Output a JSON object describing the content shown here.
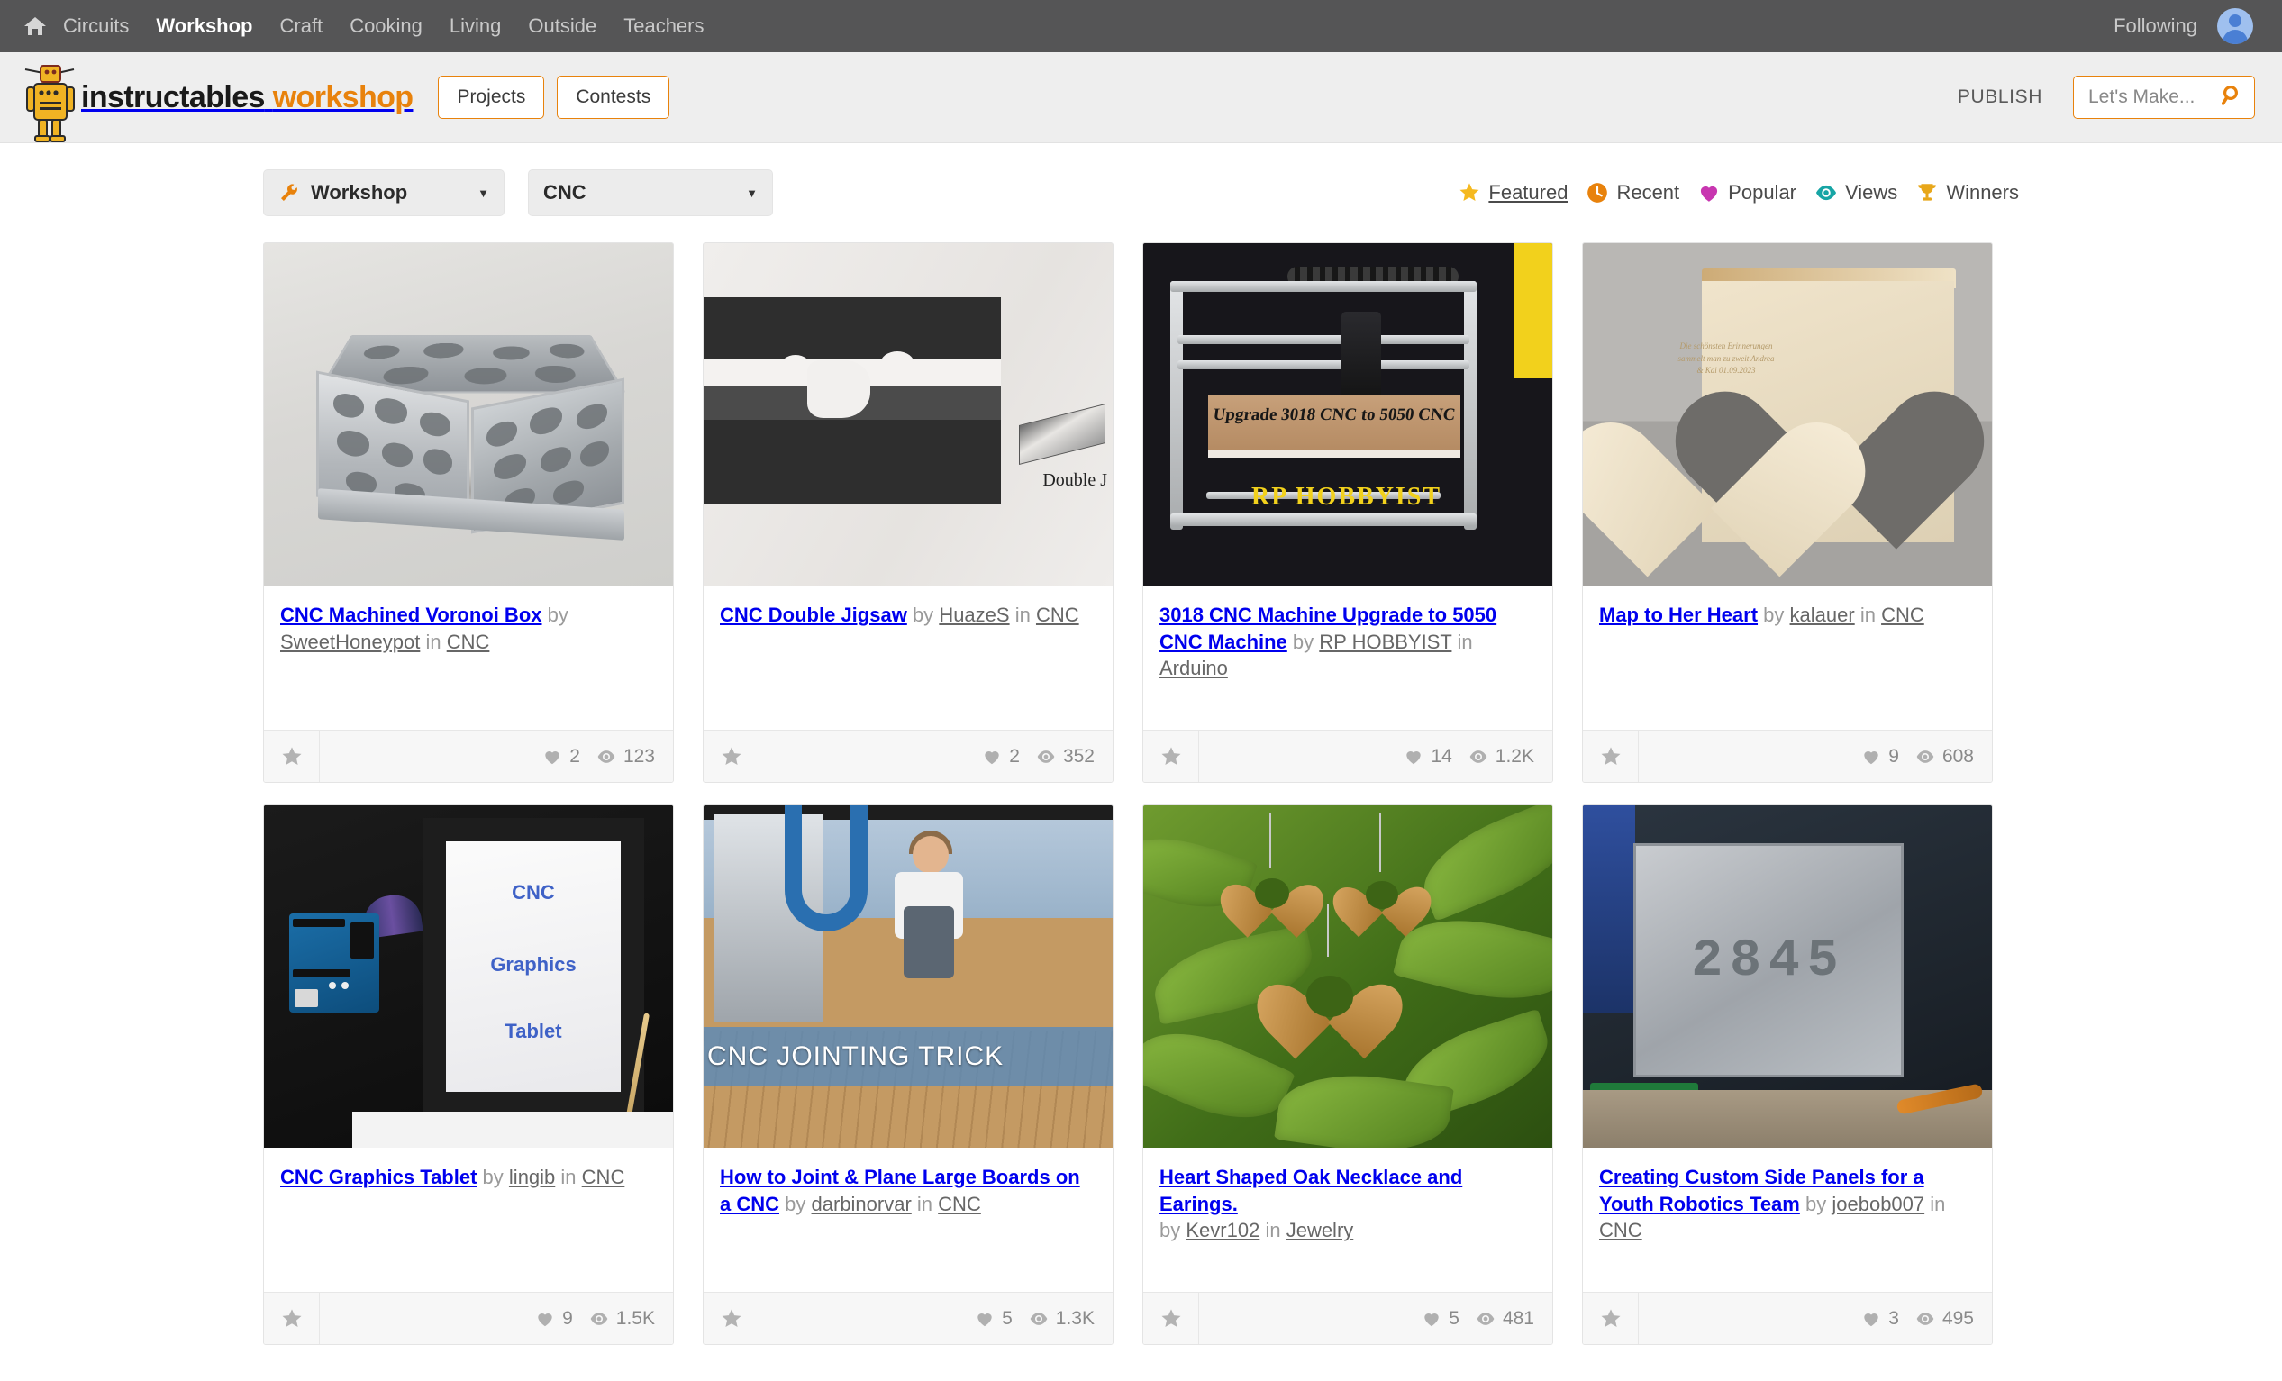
{
  "topbar": {
    "home_icon": "home-icon",
    "nav": [
      {
        "label": "Circuits",
        "active": false
      },
      {
        "label": "Workshop",
        "active": true
      },
      {
        "label": "Craft",
        "active": false
      },
      {
        "label": "Cooking",
        "active": false
      },
      {
        "label": "Living",
        "active": false
      },
      {
        "label": "Outside",
        "active": false
      },
      {
        "label": "Teachers",
        "active": false
      }
    ],
    "following_label": "Following",
    "avatar_icon": "user-avatar-icon",
    "bg_color": "#555556"
  },
  "masthead": {
    "logo_icon": "instructables-robot-logo",
    "logo_primary": "instructables",
    "logo_secondary": "workshop",
    "buttons": [
      {
        "label": "Projects"
      },
      {
        "label": "Contests"
      }
    ],
    "publish_label": "PUBLISH",
    "search": {
      "placeholder": "Let's Make...",
      "value": "",
      "icon": "search-icon"
    },
    "accent_color": "#e8820c",
    "bg_color": "#eeeeee"
  },
  "filters": {
    "channel_dropdown": {
      "icon": "wrench-icon",
      "value": "Workshop",
      "caret": "▼"
    },
    "category_dropdown": {
      "value": "CNC",
      "caret": "▼"
    }
  },
  "sort": {
    "items": [
      {
        "label": "Featured",
        "icon": "star-icon",
        "color": "#f5b920",
        "active": true
      },
      {
        "label": "Recent",
        "icon": "clock-icon",
        "color": "#e8820c",
        "active": false
      },
      {
        "label": "Popular",
        "icon": "heart-icon",
        "color": "#c836b0",
        "active": false
      },
      {
        "label": "Views",
        "icon": "eye-icon",
        "color": "#17a5a5",
        "active": false
      },
      {
        "label": "Winners",
        "icon": "trophy-icon",
        "color": "#e8a71a",
        "active": false
      }
    ]
  },
  "cards": [
    {
      "title": "CNC Machined Voronoi Box",
      "by_label": "by",
      "author": "SweetHoneypot",
      "in_label": "in",
      "channel": "CNC",
      "favorite_icon": "star-icon",
      "likes_icon": "heart-icon",
      "likes": "2",
      "views_icon": "eye-icon",
      "views": "123",
      "thumb_alt": "machined aluminium box with voronoi lattice pattern"
    },
    {
      "title": "CNC Double Jigsaw",
      "by_label": "by",
      "author": "HuazeS",
      "in_label": "in",
      "channel": "CNC",
      "favorite_icon": "star-icon",
      "likes_icon": "heart-icon",
      "likes": "2",
      "views_icon": "eye-icon",
      "views": "352",
      "thumb_alt": "black and white photocopy of interlocking double jigsaw joint",
      "thumb_text": "Double J"
    },
    {
      "title": "3018 CNC Machine Upgrade to 5050 CNC Machine",
      "by_label": "by",
      "author": "RP HOBBYIST",
      "in_label": "in",
      "channel": "Arduino",
      "favorite_icon": "star-icon",
      "likes_icon": "heart-icon",
      "likes": "14",
      "views_icon": "eye-icon",
      "views": "1.2K",
      "thumb_alt": "aluminium CNC router machine with engraved board",
      "thumb_text": "Upgrade 3018 CNC to 5050 CNC",
      "thumb_text2": "RP HOBBYIST"
    },
    {
      "title": "Map to Her Heart",
      "by_label": "by",
      "author": "kalauer",
      "in_label": "in",
      "channel": "CNC",
      "favorite_icon": "star-icon",
      "likes_icon": "heart-icon",
      "likes": "9",
      "views_icon": "eye-icon",
      "views": "608",
      "thumb_alt": "plywood box with heart cutout and engraved wooden heart plaque",
      "thumb_text": "Die schönsten Erinnerungen sammelt man zu zweit Andrea & Kai 01.09.2023"
    },
    {
      "title": "CNC Graphics Tablet",
      "by_label": "by",
      "author": "lingib",
      "in_label": "in",
      "channel": "CNC",
      "favorite_icon": "star-icon",
      "likes_icon": "heart-icon",
      "likes": "9",
      "views_icon": "eye-icon",
      "views": "1.5K",
      "thumb_alt": "Arduino board beside black frame holding paper",
      "thumb_text_1": "CNC",
      "thumb_text_2": "Graphics",
      "thumb_text_3": "Tablet"
    },
    {
      "title": "How to Joint & Plane Large Boards on a CNC",
      "by_label": "by",
      "author": "darbinorvar",
      "in_label": "in",
      "channel": "CNC",
      "favorite_icon": "star-icon",
      "likes_icon": "heart-icon",
      "likes": "5",
      "views_icon": "eye-icon",
      "views": "1.3K",
      "thumb_alt": "woman working at a CNC machine flattening a wide board",
      "thumb_text": "CNC JOINTING TRICK"
    },
    {
      "title": "Heart Shaped Oak Necklace and Earings.",
      "by_label": "by",
      "author": "Kevr102",
      "in_label": "in",
      "channel": "Jewelry",
      "favorite_icon": "star-icon",
      "likes_icon": "heart-icon",
      "likes": "5",
      "views_icon": "eye-icon",
      "views": "481",
      "thumb_alt": "three wooden heart pendants hanging among green leaves"
    },
    {
      "title": "Creating Custom Side Panels for a Youth Robotics Team",
      "by_label": "by",
      "author": "joebob007",
      "in_label": "in",
      "channel": "CNC",
      "favorite_icon": "star-icon",
      "likes_icon": "heart-icon",
      "likes": "3",
      "views_icon": "eye-icon",
      "views": "495",
      "thumb_alt": "aluminium robot side panel engraved 2845 on a workbench",
      "thumb_text": "2845"
    }
  ]
}
